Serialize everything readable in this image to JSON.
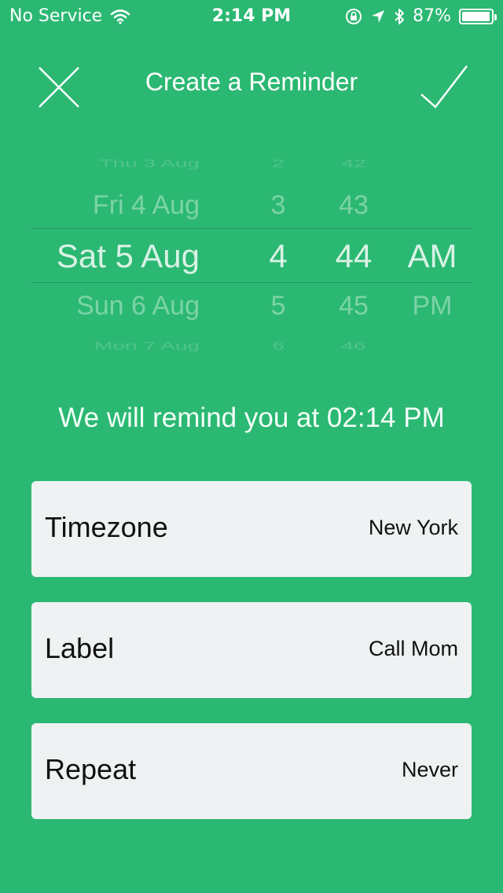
{
  "status_bar": {
    "carrier": "No Service",
    "time": "2:14 PM",
    "battery": "87%",
    "battery_level": 0.87
  },
  "header": {
    "title": "Create a Reminder",
    "close_icon": "x-icon",
    "confirm_icon": "checkmark-icon"
  },
  "picker": {
    "dates": [
      "Thu 3 Aug",
      "Fri 4 Aug",
      "Sat 5 Aug",
      "Sun 6 Aug",
      "Mon 7 Aug"
    ],
    "hours": [
      "2",
      "3",
      "4",
      "5",
      "6"
    ],
    "minutes": [
      "42",
      "43",
      "44",
      "45",
      "46"
    ],
    "ampm": [
      "AM",
      "PM"
    ],
    "selected": {
      "date": "Sat 5 Aug",
      "hour": "4",
      "minute": "44",
      "ampm": "AM"
    }
  },
  "remind_message": "We will remind you at 02:14 PM",
  "settings": [
    {
      "label": "Timezone",
      "value": "New York"
    },
    {
      "label": "Label",
      "value": "Call Mom"
    },
    {
      "label": "Repeat",
      "value": "Never"
    }
  ],
  "colors": {
    "background": "#2bb872",
    "card": "#eff2f3"
  }
}
